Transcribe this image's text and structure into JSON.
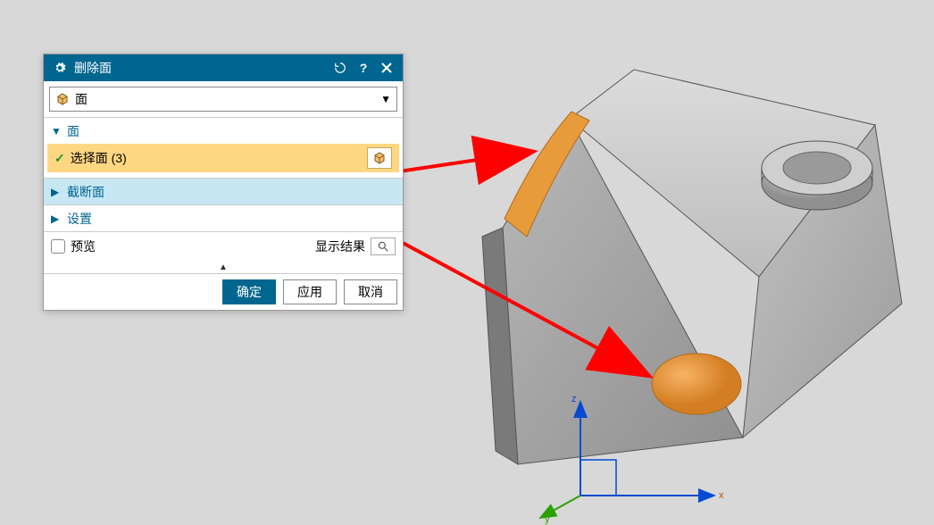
{
  "dialog": {
    "title": "删除面",
    "dropdown": {
      "label": "面"
    },
    "sections": {
      "face": {
        "label": "面",
        "expanded": true
      },
      "cutoff": {
        "label": "截断面",
        "expanded": false
      },
      "settings": {
        "label": "设置",
        "expanded": false
      }
    },
    "selection": {
      "check": "✓",
      "text": "选择面 (3)"
    },
    "preview": {
      "label": "预览"
    },
    "show_result": {
      "label": "显示结果"
    },
    "buttons": {
      "ok": "确定",
      "apply": "应用",
      "cancel": "取消"
    }
  },
  "colors": {
    "accent": "#00668f",
    "highlight": "#ffd782",
    "section_hl": "#c7e7f3",
    "selected_face": "#e89b3a"
  },
  "axes": {
    "x": "x",
    "y": "y",
    "z": "z"
  }
}
